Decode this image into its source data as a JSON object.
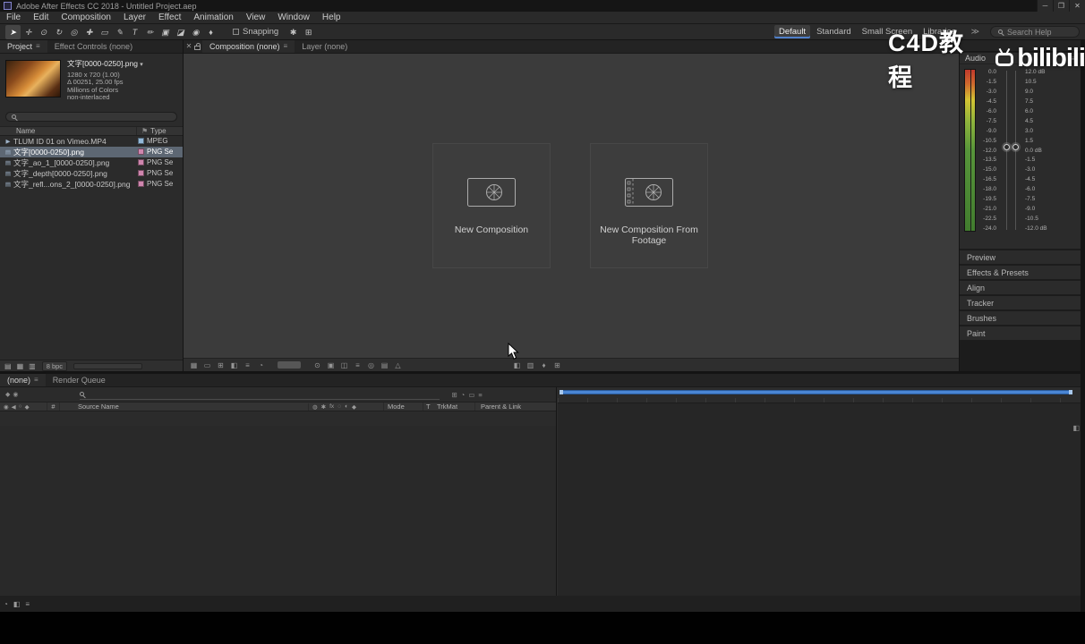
{
  "window": {
    "title": "Adobe After Effects CC 2018 - Untitled Project.aep",
    "minimize": "─",
    "maximize": "❐",
    "close": "✕"
  },
  "icons": {
    "close": "✕",
    "panel_menu": "≡",
    "overflow": "≫",
    "dropdown": "▾",
    "flag": "⚑"
  },
  "menu": [
    "File",
    "Edit",
    "Composition",
    "Layer",
    "Effect",
    "Animation",
    "View",
    "Window",
    "Help"
  ],
  "toolbar": {
    "tools": [
      {
        "name": "selection-tool",
        "glyph": "➤",
        "active": true
      },
      {
        "name": "hand-tool",
        "glyph": "✛"
      },
      {
        "name": "zoom-tool",
        "glyph": "⊙"
      },
      {
        "name": "rotation-tool",
        "glyph": "↻"
      },
      {
        "name": "camera-tool",
        "glyph": "◎"
      },
      {
        "name": "pan-behind-tool",
        "glyph": "✚"
      },
      {
        "name": "shape-tool",
        "glyph": "▭"
      },
      {
        "name": "pen-tool",
        "glyph": "✎"
      },
      {
        "name": "type-tool",
        "glyph": "T"
      },
      {
        "name": "brush-tool",
        "glyph": "✏"
      },
      {
        "name": "clone-stamp-tool",
        "glyph": "▣"
      },
      {
        "name": "eraser-tool",
        "glyph": "◪"
      },
      {
        "name": "roto-brush-tool",
        "glyph": "◉"
      },
      {
        "name": "puppet-pin-tool",
        "glyph": "♦"
      }
    ],
    "snapping": "Snapping",
    "extra_icons": [
      "✱",
      "⊞"
    ],
    "workspaces": [
      {
        "name": "workspace-default",
        "label": "Default",
        "active": true
      },
      {
        "name": "workspace-standard",
        "label": "Standard"
      },
      {
        "name": "workspace-small-screen",
        "label": "Small Screen"
      },
      {
        "name": "workspace-libraries",
        "label": "Libraries"
      }
    ],
    "search_placeholder": "Search Help"
  },
  "watermark": {
    "text": "C4D教程",
    "logo": "bilibili"
  },
  "project": {
    "tabs": [
      {
        "name": "tab-project",
        "label": "Project",
        "active": true
      },
      {
        "name": "tab-effect-controls",
        "label": "Effect Controls (none)"
      }
    ],
    "footage": {
      "name": "文字[0000-0250].png",
      "details": [
        "1280 x 720 (1.00)",
        "Δ 00251, 25.00 fps",
        "Millions of Colors",
        "non-interlaced"
      ]
    },
    "columns": {
      "name": "Name",
      "type": "Type"
    },
    "items": [
      {
        "kind": "mp4",
        "icon": "▶",
        "name": "TLUM ID 01 on Vimeo.MP4",
        "type": "MPEG"
      },
      {
        "kind": "png",
        "icon": "▤",
        "name": "文字[0000-0250].png",
        "type": "PNG Se",
        "selected": true
      },
      {
        "kind": "png",
        "icon": "▤",
        "name": "文字_ao_1_[0000-0250].png",
        "type": "PNG Se"
      },
      {
        "kind": "png",
        "icon": "▤",
        "name": "文字_depth[0000-0250].png",
        "type": "PNG Se"
      },
      {
        "kind": "png",
        "icon": "▤",
        "name": "文字_refl...ons_2_[0000-0250].png",
        "type": "PNG Se"
      }
    ],
    "footer_icons": [
      "▤",
      "▦",
      "▥"
    ],
    "bpc": "8 bpc"
  },
  "viewer": {
    "tabs": [
      {
        "name": "tab-composition",
        "label": "Composition (none)",
        "active": true
      },
      {
        "name": "tab-layer",
        "label": "Layer (none)"
      }
    ],
    "actions": [
      {
        "name": "new-composition-button",
        "label": "New Composition"
      },
      {
        "name": "new-composition-from-footage-button",
        "label": "New Composition From Footage"
      }
    ],
    "footer_icons_left": [
      "▦",
      "▭",
      "⊞",
      "◧",
      "≡",
      "◔"
    ],
    "footer_icons_mid": [
      "⊙",
      "▣",
      "◫",
      "≡",
      "◎",
      "▤",
      "△"
    ],
    "footer_icons_right": [
      "◧",
      "▥",
      "♦",
      "⊞"
    ]
  },
  "audio": {
    "title": "Audio",
    "left_scale": [
      "0.0",
      "-1.5",
      "-3.0",
      "-4.5",
      "-6.0",
      "-7.5",
      "-9.0",
      "-10.5",
      "-12.0",
      "-13.5",
      "-15.0",
      "-16.5",
      "-18.0",
      "-19.5",
      "-21.0",
      "-22.5",
      "-24.0"
    ],
    "right_scale": [
      "12.0 dB",
      "10.5",
      "9.0",
      "7.5",
      "6.0",
      "4.5",
      "3.0",
      "1.5",
      "0.0 dB",
      "-1.5",
      "-3.0",
      "-4.5",
      "-6.0",
      "-7.5",
      "-9.0",
      "-10.5",
      "-12.0 dB"
    ]
  },
  "right_panels": [
    {
      "name": "panel-preview",
      "label": "Preview"
    },
    {
      "name": "panel-effects-presets",
      "label": "Effects & Presets"
    },
    {
      "name": "panel-align",
      "label": "Align"
    },
    {
      "name": "panel-tracker",
      "label": "Tracker"
    },
    {
      "name": "panel-brushes",
      "label": "Brushes"
    },
    {
      "name": "panel-paint",
      "label": "Paint"
    }
  ],
  "timeline": {
    "tabs": [
      {
        "name": "tab-timeline-none",
        "label": "(none)",
        "active": true
      },
      {
        "name": "tab-render-queue",
        "label": "Render Queue"
      }
    ],
    "mini_icons": [
      "◆",
      "◉"
    ],
    "search_icons": [
      "⊞",
      "◔",
      "▭",
      "≡"
    ],
    "left_header_icons": [
      "◉",
      "◀",
      "○",
      "◆"
    ],
    "hash": "#",
    "source_name": "Source Name",
    "switch_icons": [
      "◍",
      "✱",
      "fx",
      "◌",
      "◐",
      "◆"
    ],
    "mode": "Mode",
    "t": "T",
    "trkmat": "TrkMat",
    "parent": "Parent & Link",
    "footer_icons": [
      "◔",
      "◧",
      "≡"
    ],
    "scroll_icon": "◧"
  },
  "taskbar_icons": [
    "◫",
    "▤",
    "◔",
    "⊞",
    "▣",
    "◈",
    "▶",
    "◆",
    "▦",
    "◉"
  ]
}
